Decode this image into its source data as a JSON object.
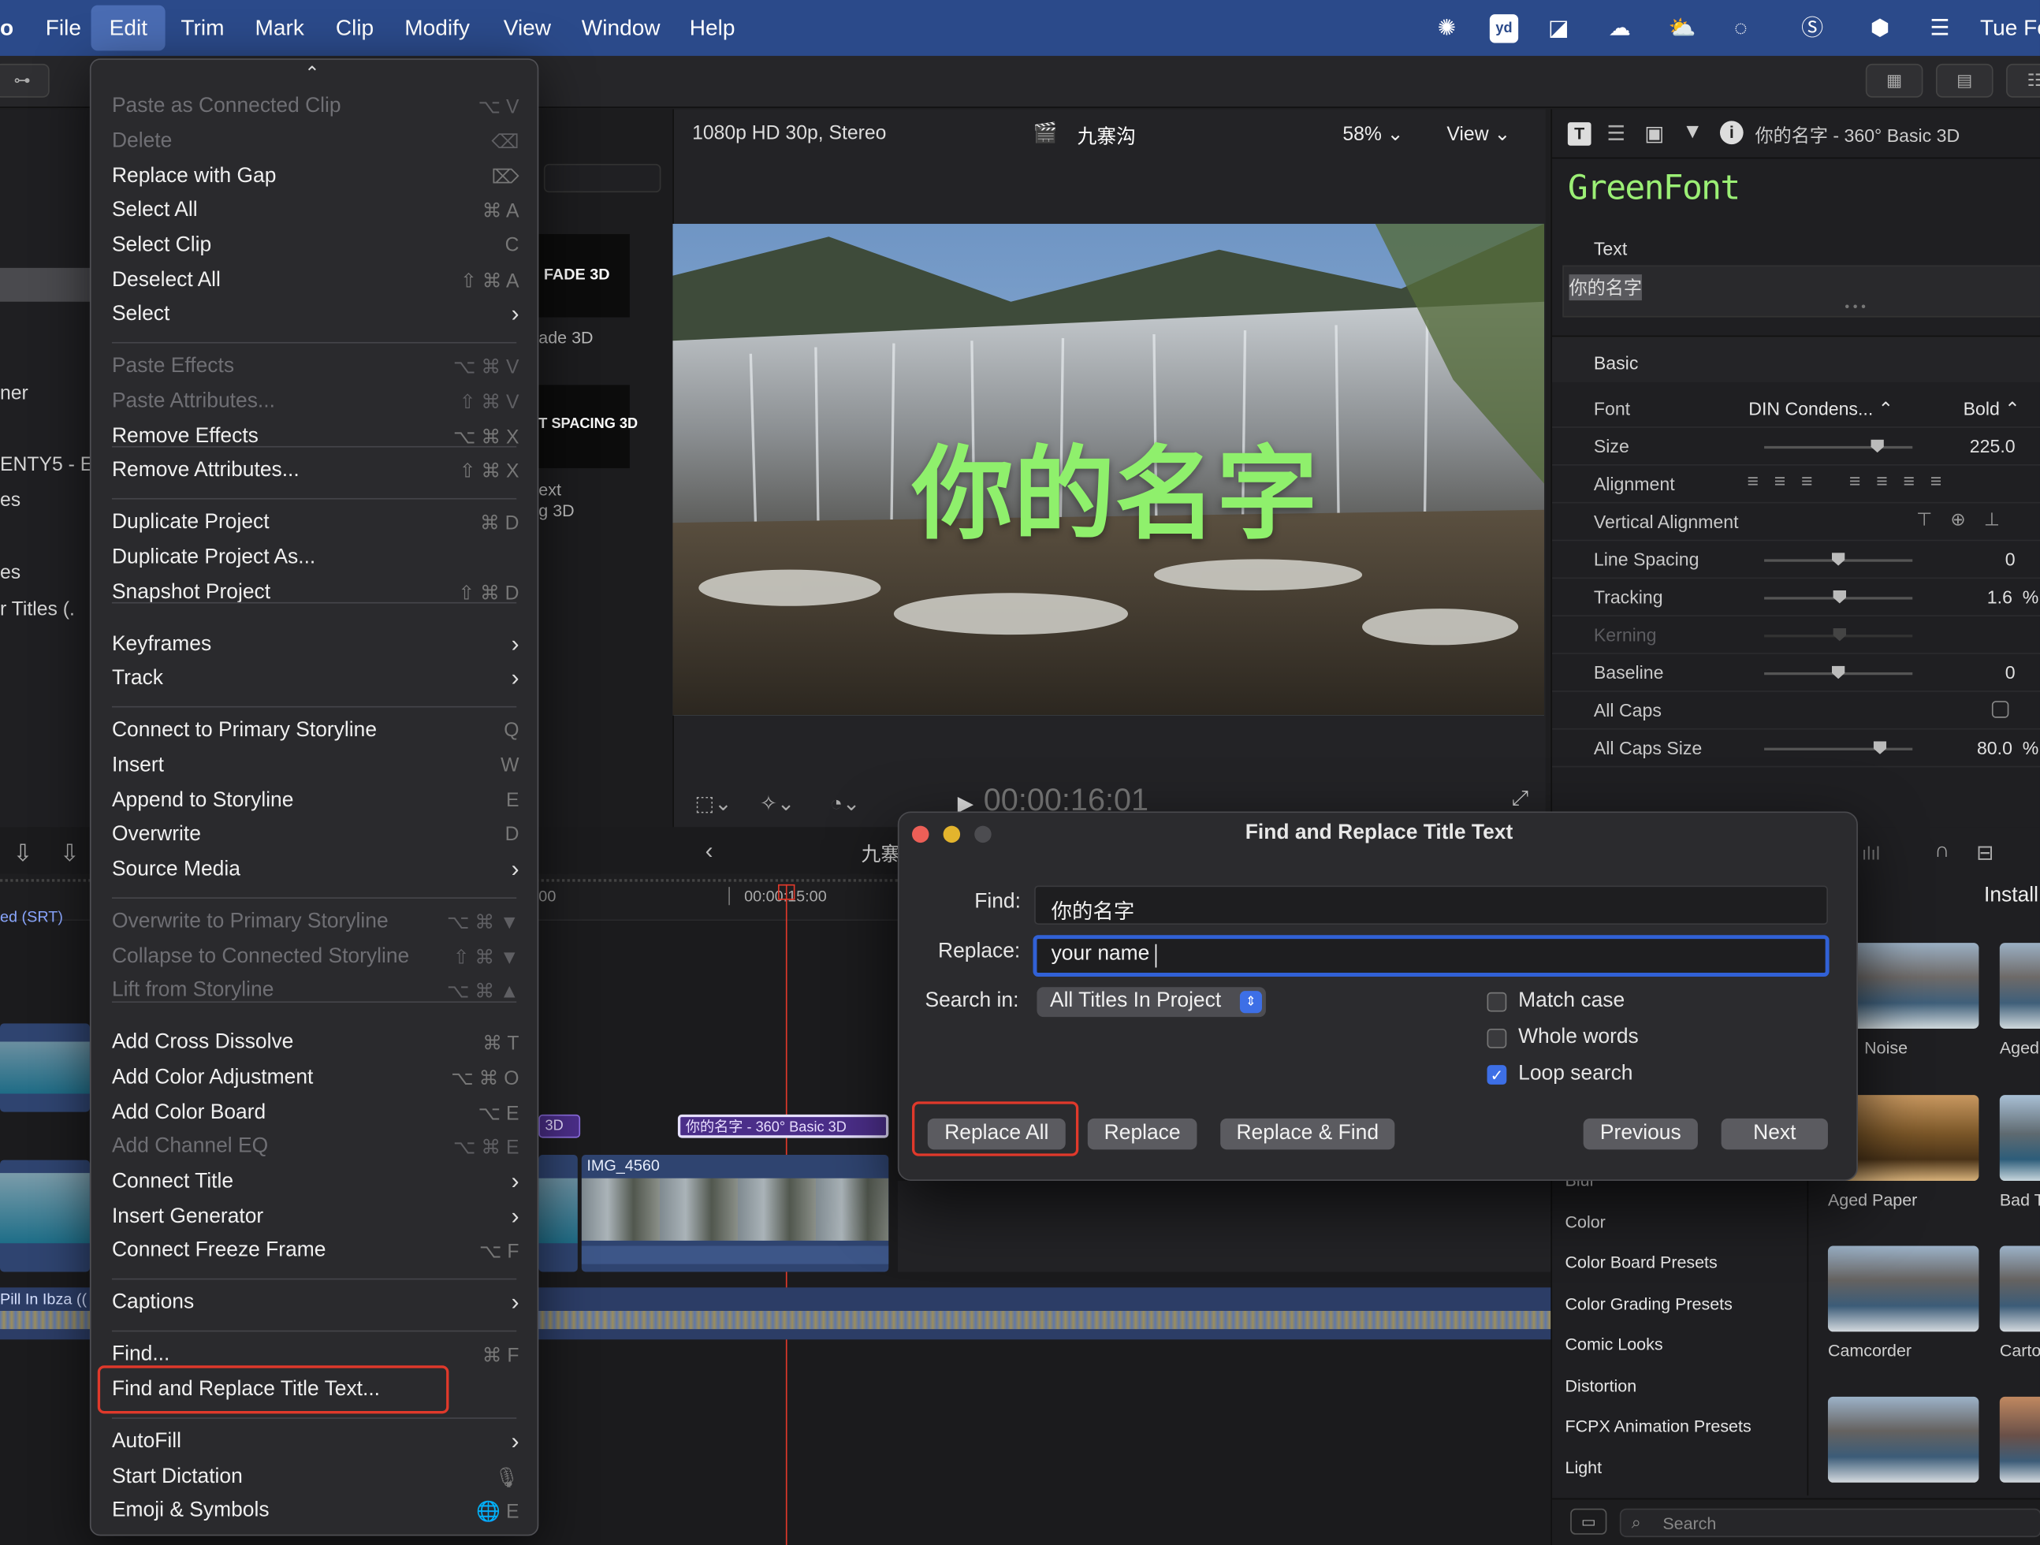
{
  "menubar": {
    "app_fragment": "o",
    "items": [
      "File",
      "Edit",
      "Trim",
      "Mark",
      "Clip",
      "Modify",
      "View",
      "Window",
      "Help"
    ],
    "clock": "Tue Fe"
  },
  "viewer": {
    "format": "1080p HD 30p, Stereo",
    "project": "九寨沟",
    "zoom": "58%",
    "view": "View",
    "overlay_title": "你的名字",
    "timecode": "00:00:16:01"
  },
  "browser": {
    "thumb1": "FADE 3D",
    "caption1": "ade 3D",
    "thumb2": "T SPACING 3D",
    "caption2a": "ext",
    "caption2b": "g 3D"
  },
  "left_panel": {
    "items": [
      "ner",
      "ENTY5 - E",
      "es",
      "es",
      "r Titles (."
    ]
  },
  "inspector": {
    "header_title": "你的名字 - 360° Basic 3D",
    "font_preview": "GreenFont",
    "text_section": "Text",
    "text_value": "你的名字",
    "basic_section": "Basic",
    "rows": {
      "font": {
        "label": "Font",
        "value": "DIN Condens...",
        "weight": "Bold"
      },
      "size": {
        "label": "Size",
        "value": "225.0"
      },
      "alignment": {
        "label": "Alignment"
      },
      "valign": {
        "label": "Vertical Alignment"
      },
      "line_spacing": {
        "label": "Line Spacing",
        "value": "0"
      },
      "tracking": {
        "label": "Tracking",
        "value": "1.6",
        "unit": "%"
      },
      "kerning": {
        "label": "Kerning"
      },
      "baseline": {
        "label": "Baseline",
        "value": "0"
      },
      "all_caps": {
        "label": "All Caps",
        "checked": false
      },
      "all_caps_size": {
        "label": "All Caps Size",
        "value": "80.0",
        "unit": "%"
      }
    }
  },
  "timeline": {
    "project": "九寨",
    "ruler_left": "00",
    "ruler_tc": "00:00:15:00",
    "caption_track": "ed (SRT)",
    "title_clip_short": "3D",
    "title_clip": "你的名字 - 360° Basic 3D",
    "video_clip": "IMG_4560",
    "audio_clip": "Pill In Ibza (("
  },
  "effects": {
    "install_label": "Install",
    "categories": [
      "Blur",
      "Color",
      "Color Board Presets",
      "Color Grading Presets",
      "Comic Looks",
      "Distortion",
      "FCPX Animation Presets",
      "Light"
    ],
    "thumbs": [
      "Noise",
      "Aged",
      "Aged Paper",
      "Bad T",
      "Camcorder",
      "Carto"
    ],
    "search_placeholder": "Search"
  },
  "edit_menu": {
    "items": [
      {
        "label": "Paste as Connected Clip",
        "shortcut": "⌥ V",
        "disabled": true
      },
      {
        "label": "Delete",
        "shortcut": "⌫",
        "disabled": true
      },
      {
        "label": "Replace with Gap",
        "shortcut": "⌦",
        "disabled": false
      },
      {
        "label": "Select All",
        "shortcut": "⌘ A",
        "disabled": false
      },
      {
        "label": "Select Clip",
        "shortcut": "C",
        "disabled": false
      },
      {
        "label": "Deselect All",
        "shortcut": "⇧ ⌘ A",
        "disabled": false
      },
      {
        "label": "Select",
        "shortcut": "",
        "submenu": true,
        "disabled": false
      },
      {
        "label": "Paste Effects",
        "shortcut": "⌥ ⌘ V",
        "disabled": true
      },
      {
        "label": "Paste Attributes...",
        "shortcut": "⇧ ⌘ V",
        "disabled": true
      },
      {
        "label": "Remove Effects",
        "shortcut": "⌥ ⌘ X",
        "disabled": false
      },
      {
        "label": "Remove Attributes...",
        "shortcut": "⇧ ⌘ X",
        "disabled": false
      },
      {
        "label": "Duplicate Project",
        "shortcut": "⌘ D",
        "disabled": false
      },
      {
        "label": "Duplicate Project As...",
        "shortcut": "",
        "disabled": false
      },
      {
        "label": "Snapshot Project",
        "shortcut": "⇧ ⌘ D",
        "disabled": false
      },
      {
        "label": "Keyframes",
        "shortcut": "",
        "submenu": true,
        "disabled": false
      },
      {
        "label": "Track",
        "shortcut": "",
        "submenu": true,
        "disabled": false
      },
      {
        "label": "Connect to Primary Storyline",
        "shortcut": "Q",
        "disabled": false
      },
      {
        "label": "Insert",
        "shortcut": "W",
        "disabled": false
      },
      {
        "label": "Append to Storyline",
        "shortcut": "E",
        "disabled": false
      },
      {
        "label": "Overwrite",
        "shortcut": "D",
        "disabled": false
      },
      {
        "label": "Source Media",
        "shortcut": "",
        "submenu": true,
        "disabled": false
      },
      {
        "label": "Overwrite to Primary Storyline",
        "shortcut": "⌥ ⌘ ▼",
        "disabled": true
      },
      {
        "label": "Collapse to Connected Storyline",
        "shortcut": "⇧ ⌘ ▼",
        "disabled": true
      },
      {
        "label": "Lift from Storyline",
        "shortcut": "⌥ ⌘ ▲",
        "disabled": true
      },
      {
        "label": "Add Cross Dissolve",
        "shortcut": "⌘ T",
        "disabled": false
      },
      {
        "label": "Add Color Adjustment",
        "shortcut": "⌥ ⌘ O",
        "disabled": false
      },
      {
        "label": "Add Color Board",
        "shortcut": "⌥ E",
        "disabled": false
      },
      {
        "label": "Add Channel EQ",
        "shortcut": "⌥ ⌘ E",
        "disabled": true
      },
      {
        "label": "Connect Title",
        "shortcut": "",
        "submenu": true,
        "disabled": false
      },
      {
        "label": "Insert Generator",
        "shortcut": "",
        "submenu": true,
        "disabled": false
      },
      {
        "label": "Connect Freeze Frame",
        "shortcut": "⌥ F",
        "disabled": false
      },
      {
        "label": "Captions",
        "shortcut": "",
        "submenu": true,
        "disabled": false
      },
      {
        "label": "Find...",
        "shortcut": "⌘ F",
        "disabled": false
      },
      {
        "label": "Find and Replace Title Text...",
        "shortcut": "",
        "disabled": false
      },
      {
        "label": "AutoFill",
        "shortcut": "",
        "submenu": true,
        "disabled": false
      },
      {
        "label": "Start Dictation",
        "shortcut": "🎙",
        "disabled": false
      },
      {
        "label": "Emoji & Symbols",
        "shortcut": "🌐 E",
        "disabled": false
      }
    ]
  },
  "dialog": {
    "title": "Find and Replace Title Text",
    "find_label": "Find:",
    "find_value": "你的名字",
    "replace_label": "Replace:",
    "replace_value": "your name",
    "search_in_label": "Search in:",
    "search_in_value": "All Titles In Project",
    "match_case": "Match case",
    "whole_words": "Whole words",
    "loop_search": "Loop search",
    "buttons": {
      "replace_all": "Replace All",
      "replace": "Replace",
      "replace_find": "Replace & Find",
      "previous": "Previous",
      "next": "Next"
    }
  }
}
